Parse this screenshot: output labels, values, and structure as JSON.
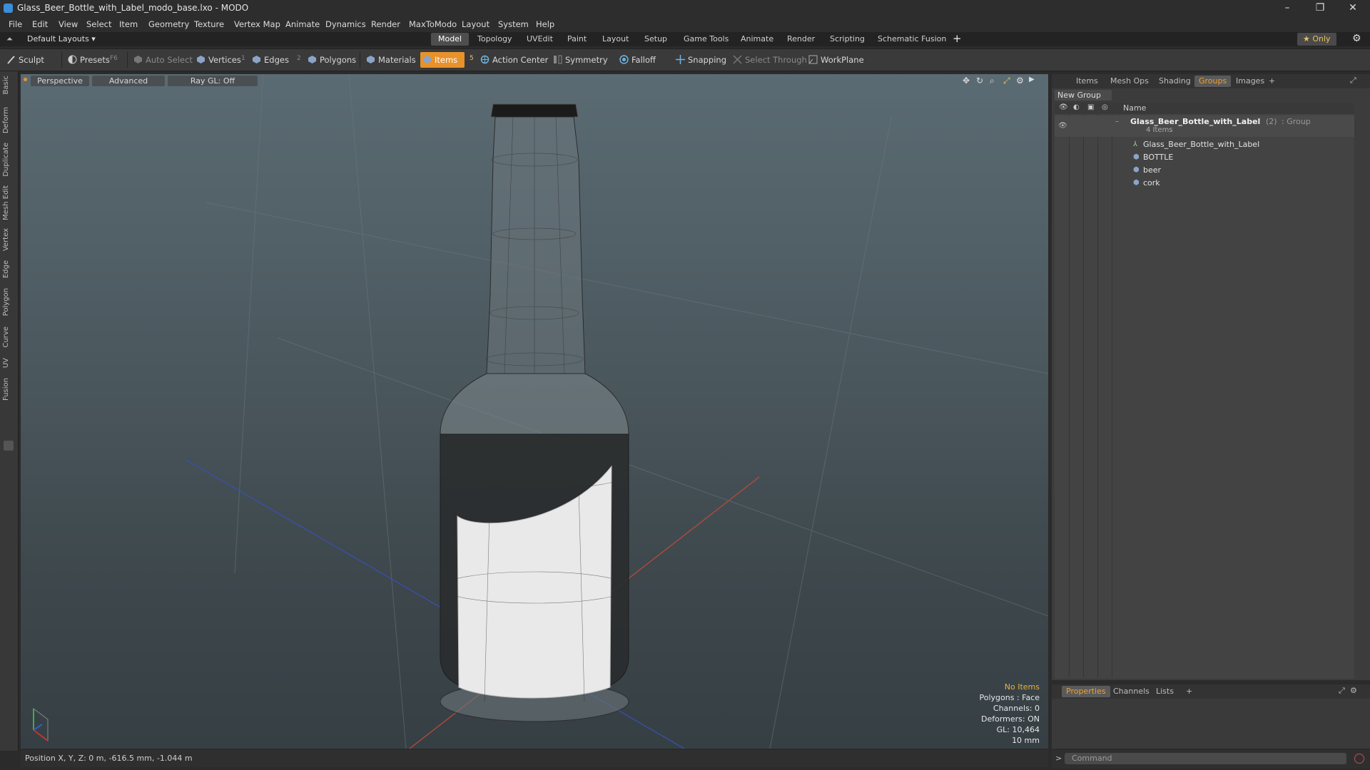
{
  "window": {
    "title": "Glass_Beer_Bottle_with_Label_modo_base.lxo - MODO",
    "controls": [
      "–",
      "❐",
      "✕"
    ]
  },
  "menu": [
    "File",
    "Edit",
    "View",
    "Select",
    "Item",
    "Geometry",
    "Texture",
    "Vertex Map",
    "Animate",
    "Dynamics",
    "Render",
    "MaxToModo",
    "Layout",
    "System",
    "Help"
  ],
  "layouts": {
    "preset_label": "Default Layouts ▾",
    "tabs": [
      "Model",
      "Topology",
      "UVEdit",
      "Paint",
      "Layout",
      "Setup",
      "Game Tools",
      "Animate",
      "Render",
      "Scripting",
      "Schematic Fusion"
    ],
    "active_tab": "Model",
    "add": "+",
    "only_label": "★  Only"
  },
  "toolbar": {
    "sculpt": "Sculpt",
    "presets": "Presets",
    "presets_key": "F6",
    "auto_select": "Auto Select",
    "vertices": "Vertices",
    "vertices_key": "1",
    "edges": "Edges",
    "edges_key": "2",
    "polygons": "Polygons",
    "materials": "Materials",
    "items": "Items",
    "items_key": "5",
    "action_center": "Action Center",
    "symmetry": "Symmetry",
    "falloff": "Falloff",
    "snapping": "Snapping",
    "select_through": "Select Through",
    "workplane": "WorkPlane",
    "accent": "#e8922b"
  },
  "left_tabs": [
    "Basic",
    "Deform",
    "Duplicate",
    "Mesh Edit",
    "Vertex",
    "Edge",
    "Polygon",
    "Curve",
    "UV",
    "Fusion"
  ],
  "viewport": {
    "view": "Perspective",
    "mode": "Advanced",
    "raygl": "Ray GL: Off",
    "info": [
      "No Items",
      "Polygons : Face",
      "Channels: 0",
      "Deformers: ON",
      "GL: 10,464",
      "10 mm"
    ],
    "status": "Position X, Y, Z:  0 m, -616.5 mm, -1.044 m"
  },
  "right_panel": {
    "tabs": [
      "Items",
      "Mesh Ops",
      "Shading",
      "Groups",
      "Images",
      "+"
    ],
    "active_tab": "Groups",
    "new_group": "New Group",
    "column_name": "Name",
    "group": {
      "name": "Glass_Beer_Bottle_with_Label",
      "count": "(2)",
      "type": ": Group",
      "subtitle": "4 Items"
    },
    "children": [
      "Glass_Beer_Bottle_with_Label",
      "BOTTLE",
      "beer",
      "cork"
    ],
    "bottom_tabs": [
      "Properties",
      "Channels",
      "Lists",
      "+"
    ],
    "bottom_active": "Properties",
    "command_placeholder": "Command"
  }
}
